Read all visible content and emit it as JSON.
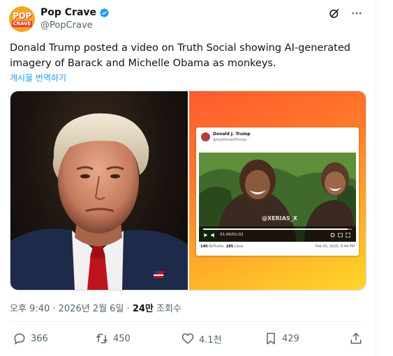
{
  "author": {
    "name": "Pop Crave",
    "handle": "@PopCrave",
    "avatar_text_top": "POP",
    "avatar_text_bottom": "CRAVE"
  },
  "icons": {
    "verified": "verified-badge-icon",
    "grok": "grok-icon",
    "more": "more-icon",
    "reply": "reply-icon",
    "retweet": "retweet-icon",
    "like": "like-icon",
    "bookmark": "bookmark-icon",
    "share": "share-icon"
  },
  "tweet": {
    "text": "Donald Trump posted a video on Truth Social showing AI-generated imagery of Barack and Michelle Obama as monkeys.",
    "translate_label": "게시물 번역하기"
  },
  "embedded_post": {
    "name": "Donald J. Trump",
    "handle": "@realDonaldTrump",
    "watermark": "@XERIAS_X",
    "video_time": "01:00/01:02",
    "video_progress": 0.97,
    "retruths_count": "140",
    "retruths_label": "ReTruths",
    "likes_count": "285",
    "likes_label": "Likes",
    "date": "Feb 05, 2026, 8:44 PM"
  },
  "meta": {
    "time": "오후 9:40 · 2026년 2월 6일 · ",
    "views_count": "24만",
    "views_label": " 조회수"
  },
  "actions": {
    "replies": "366",
    "retweets": "450",
    "likes": "4.1천",
    "bookmarks": "429"
  },
  "colors": {
    "accent": "#1d9bf0",
    "secondary_text": "#536471",
    "brand_orange": "#f5a623"
  }
}
